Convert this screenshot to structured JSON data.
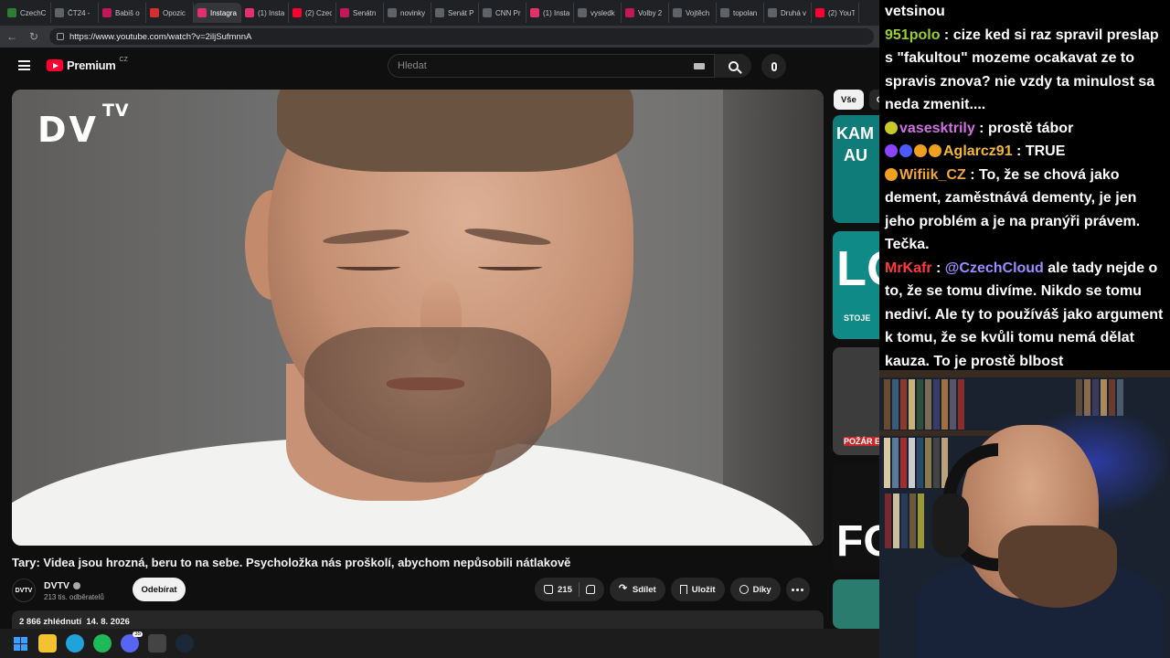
{
  "browser": {
    "tabs": [
      {
        "label": "CzechC",
        "color": "#2e7d32"
      },
      {
        "label": "ČT24 -",
        "color": "#5f6368"
      },
      {
        "label": "Babiš o",
        "color": "#c2185b"
      },
      {
        "label": "Opozic",
        "color": "#d32f2f"
      },
      {
        "label": "Instagra",
        "color": "#e1306c"
      },
      {
        "label": "(1) Insta",
        "color": "#e1306c"
      },
      {
        "label": "(2) Czec",
        "color": "#ff0033"
      },
      {
        "label": "Senátn",
        "color": "#c2185b"
      },
      {
        "label": "novinky",
        "color": "#5f6368"
      },
      {
        "label": "Senát P",
        "color": "#5f6368"
      },
      {
        "label": "CNN Pr",
        "color": "#5f6368"
      },
      {
        "label": "(1) Insta",
        "color": "#e1306c"
      },
      {
        "label": "vysledk",
        "color": "#5f6368"
      },
      {
        "label": "Volby 2",
        "color": "#c2185b"
      },
      {
        "label": "Vojtěch",
        "color": "#5f6368"
      },
      {
        "label": "topolan",
        "color": "#5f6368"
      },
      {
        "label": "Druhá v",
        "color": "#5f6368"
      },
      {
        "label": "(2) YouT",
        "color": "#ff0033"
      }
    ],
    "active_tab_index": 4,
    "url": "https://www.youtube.com/watch?v=2iljSufmnnA"
  },
  "youtube": {
    "logo_word": "Premium",
    "logo_country": "CZ",
    "search_placeholder": "Hledat",
    "player": {
      "brand": "DV",
      "brand_sup": "TV"
    },
    "video_title": "Tary: Videa jsou hrozná, beru to na sebe. Psycholožka nás proškolí, abychom nepůsobili nátlakově",
    "channel": {
      "avatar_text": "DVTV",
      "name": "DVTV",
      "subscribers": "213 tis. odběratelů",
      "subscribe_label": "Odebírat"
    },
    "actions": {
      "likes": "215",
      "share": "Sdílet",
      "save": "Uložit",
      "thanks": "Díky"
    },
    "description_meta": "2 866 zhlédnutí  14. 8. 2026",
    "chips": [
      "Vše",
      "O"
    ],
    "suggestions": [
      {
        "label": "KAM",
        "label2": "AU",
        "bg": "#0f7c7a"
      },
      {
        "label": "LO",
        "label2": "STOJE",
        "bg": "#0f8a86"
      },
      {
        "label": "",
        "label2": "POŽÁR E",
        "bg": "#3c3c3c"
      },
      {
        "label": "FO",
        "label2": "",
        "bg": "#111111"
      },
      {
        "label": "",
        "label2": "",
        "bg": "#2a7d6e"
      }
    ]
  },
  "taskbar": {
    "icons": [
      {
        "name": "windows-start-icon",
        "color": "#3aa0ff"
      },
      {
        "name": "file-explorer-icon",
        "color": "#f2c230"
      },
      {
        "name": "edge-browser-icon",
        "color": "#1fa3d8"
      },
      {
        "name": "spotify-icon",
        "color": "#1db954"
      },
      {
        "name": "discord-icon",
        "color": "#5865f2"
      },
      {
        "name": "obs-icon",
        "color": "#444444"
      },
      {
        "name": "steam-icon",
        "color": "#1b2838"
      }
    ],
    "discord_badge": "35"
  },
  "chat": {
    "messages": [
      {
        "user": "",
        "user_color": "#ffffff",
        "badges": [],
        "text": "vetsinou"
      },
      {
        "user": "951polo",
        "user_color": "#9acd32",
        "badges": [],
        "text": " : cize ked si raz spravil preslap s \"fakultou\" mozeme ocakavat ze to spravis znova? nie vzdy ta minulost sa neda zmenit...."
      },
      {
        "user": "vasesktrily",
        "user_color": "#d06fe0",
        "badges": [
          "#c9c92a"
        ],
        "text": " : prostě tábor"
      },
      {
        "user": "Aglarcz91",
        "user_color": "#f3b73a",
        "badges": [
          "#8e44ff",
          "#4a5bff",
          "#f0a020",
          "#f0a020"
        ],
        "text": " : TRUE"
      },
      {
        "user": "Wifiik_CZ",
        "user_color": "#f3a53a",
        "badges": [
          "#f0a020"
        ],
        "text": " : To, že se chová jako dement, zaměstnává dementy, je jen jeho problém a je na pranýři právem. Tečka."
      },
      {
        "user": "MrKafr",
        "user_color": "#ff3b3b",
        "badges": [],
        "mention": "@CzechCloud",
        "text": " ale tady nejde o to, že se tomu divíme. Nikdo se tomu nediví. Ale ty to používáš jako argument k tomu, že se kvůli tomu nemá dělat kauza. To je prostě blbost"
      }
    ]
  }
}
